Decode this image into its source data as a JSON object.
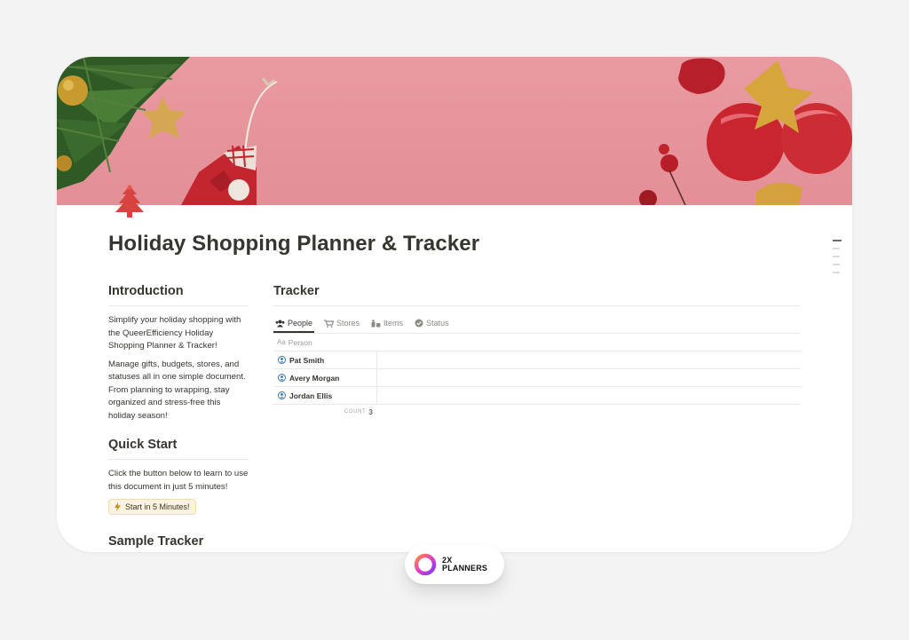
{
  "page": {
    "title": "Holiday Shopping Planner & Tracker",
    "icon": "christmas-tree-icon"
  },
  "colors": {
    "cover": "#e99aa0",
    "callout_bg": "#fbf3db",
    "ornament_red": "#c8252e",
    "gold": "#c99a2e"
  },
  "introduction": {
    "heading": "Introduction",
    "paragraph_1": "Simplify your holiday shopping with the QueerEfficiency Holiday Shopping Planner & Tracker!",
    "paragraph_2": "Manage gifts, budgets, stores, and statuses all in one simple document. From planning to wrapping, stay organized and stress-free this holiday season!"
  },
  "quick_start": {
    "heading": "Quick Start",
    "paragraph": "Click the button below to learn to use this document in just 5 minutes!",
    "button_label": "Start in 5 Minutes!",
    "button_icon": "lightning-icon"
  },
  "sample_tracker": {
    "heading": "Sample Tracker"
  },
  "tracker": {
    "heading": "Tracker",
    "tabs": [
      {
        "label": "People",
        "icon": "people-icon"
      },
      {
        "label": "Stores",
        "icon": "cart-icon"
      },
      {
        "label": "Items",
        "icon": "items-icon"
      },
      {
        "label": "Status",
        "icon": "status-check-icon"
      }
    ],
    "column_header": "Person",
    "column_icon_text": "Aa",
    "rows": [
      {
        "name": "Pat Smith"
      },
      {
        "name": "Avery Morgan"
      },
      {
        "name": "Jordan Ellis"
      }
    ],
    "count_label": "COUNT",
    "count_value": "3"
  },
  "branding": {
    "line_1": "2X",
    "line_2": "PLANNERS"
  }
}
